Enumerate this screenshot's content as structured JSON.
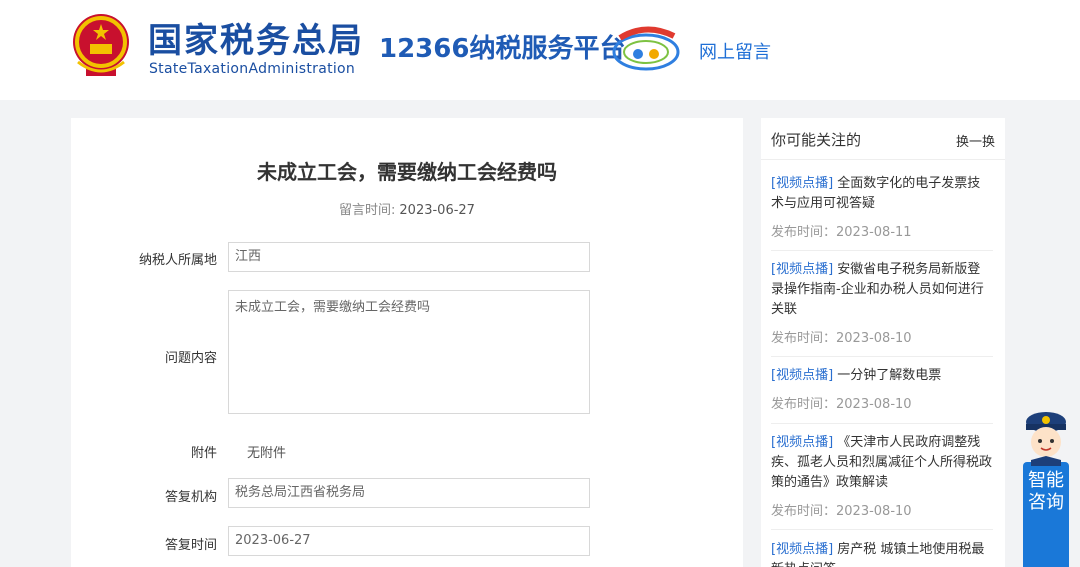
{
  "header": {
    "brand_cn": "国家税务总局",
    "brand_en": "StateTaxationAdministration",
    "platform_title": "12366纳税服务平台",
    "message_link": "网上留言",
    "colors": {
      "brand": "#1a4ea1",
      "link": "#1f6fd6"
    }
  },
  "question": {
    "title": "未成立工会，需要缴纳工会经费吗",
    "time_label": "留言时间:",
    "time_value": "2023-06-27",
    "fields": {
      "region_label": "纳税人所属地",
      "region_value": "江西",
      "content_label": "问题内容",
      "content_value": "未成立工会，需要缴纳工会经费吗",
      "attachment_label": "附件",
      "attachment_value": "无附件",
      "org_label": "答复机构",
      "org_value": "税务总局江西省税务局",
      "reply_time_label": "答复时间",
      "reply_time_value": "2023-06-27"
    }
  },
  "sidebar": {
    "title": "你可能关注的",
    "refresh_label": "换一换",
    "items": [
      {
        "tag": "[视频点播]",
        "text": "全面数字化的电子发票技术与应用可视答疑",
        "date": "发布时间：2023-08-11"
      },
      {
        "tag": "[视频点播]",
        "text": "安徽省电子税务局新版登录操作指南-企业和办税人员如何进行关联",
        "date": "发布时间：2023-08-10"
      },
      {
        "tag": "[视频点播]",
        "text": "一分钟了解数电票",
        "date": "发布时间：2023-08-10"
      },
      {
        "tag": "[视频点播]",
        "text": "《天津市人民政府调整残疾、孤老人员和烈属减征个人所得税政策的通告》政策解读",
        "date": "发布时间：2023-08-10"
      },
      {
        "tag": "[视频点播]",
        "text": "房产税 城镇土地使用税最新热点问答",
        "date": ""
      }
    ],
    "colors": {
      "tag": "#2a6fd0"
    }
  },
  "assistant": {
    "label": "智能咨询",
    "icon": "tax-officer-avatar-icon",
    "color": "#1a78d8"
  }
}
